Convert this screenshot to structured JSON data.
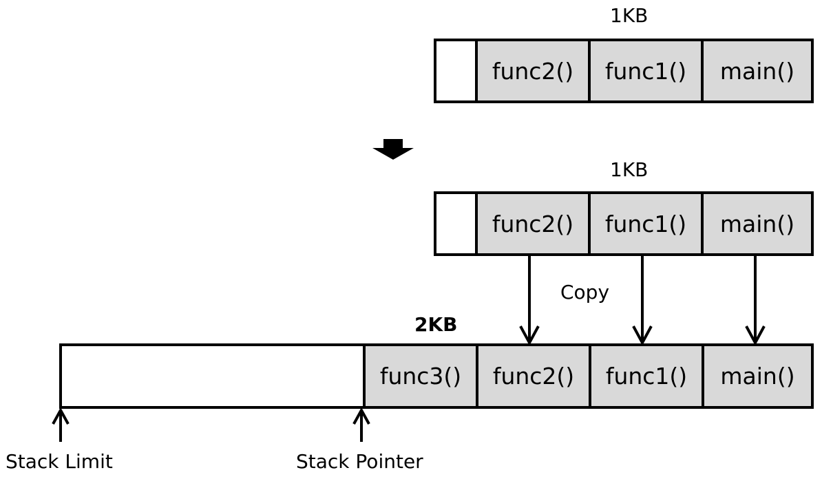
{
  "top_stack": {
    "size_label": "1KB",
    "frames": [
      "func2()",
      "func1()",
      "main()"
    ]
  },
  "transition_arrow": "down-arrow-icon",
  "middle_stack": {
    "size_label": "1KB",
    "frames": [
      "func2()",
      "func1()",
      "main()"
    ]
  },
  "copy_label": "Copy",
  "bottom_stack": {
    "size_label": "2KB",
    "frames": [
      "func3()",
      "func2()",
      "func1()",
      "main()"
    ]
  },
  "pointers": {
    "stack_limit": "Stack Limit",
    "stack_pointer": "Stack Pointer"
  },
  "colors": {
    "frame_fill": "#d9d9d9",
    "border": "#000000",
    "background": "#ffffff"
  }
}
